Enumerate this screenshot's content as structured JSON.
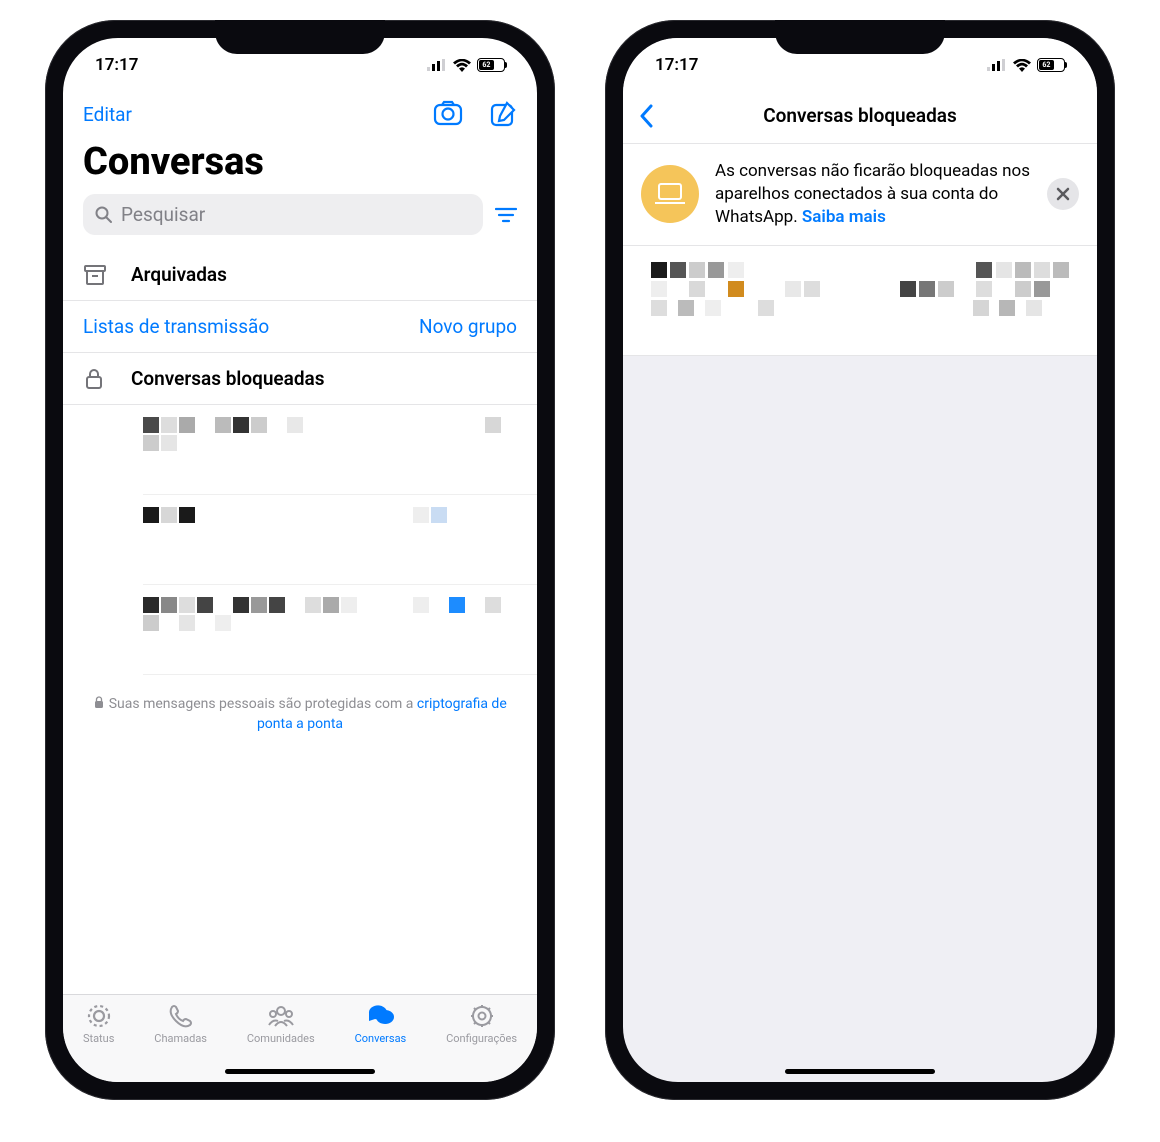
{
  "statusbar": {
    "time": "17:17",
    "battery": "62"
  },
  "screen1": {
    "edit": "Editar",
    "title": "Conversas",
    "search_placeholder": "Pesquisar",
    "archived": "Arquivadas",
    "broadcast": "Listas de transmissão",
    "newgroup": "Novo grupo",
    "locked": "Conversas bloqueadas",
    "footer_prefix": "Suas mensagens pessoais são protegidas com a ",
    "footer_link": "criptografia de ponta a ponta",
    "tabs": {
      "status": "Status",
      "calls": "Chamadas",
      "communities": "Comunidades",
      "chats": "Conversas",
      "settings": "Configurações"
    }
  },
  "screen2": {
    "title": "Conversas bloqueadas",
    "banner_text": "As conversas não ficarão bloqueadas nos aparelhos conectados à sua conta do WhatsApp. ",
    "banner_link": "Saiba mais"
  }
}
